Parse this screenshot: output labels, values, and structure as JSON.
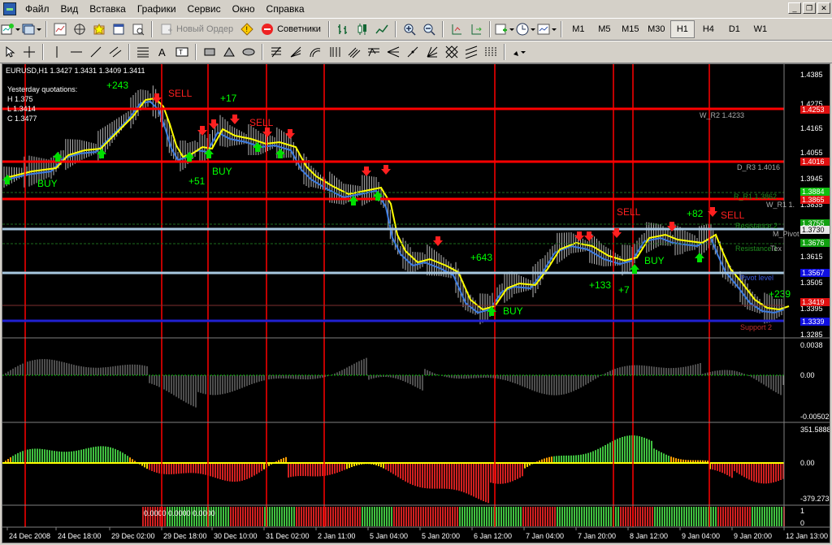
{
  "menu": [
    "Файл",
    "Вид",
    "Вставка",
    "Графики",
    "Сервис",
    "Окно",
    "Справка"
  ],
  "toolbar": {
    "new_order": "Новый Ордер",
    "experts": "Советники",
    "timeframes": [
      "M1",
      "M5",
      "M15",
      "M30",
      "H1",
      "H4",
      "D1",
      "W1"
    ],
    "active_timeframe": "H1"
  },
  "chart": {
    "symbol_line": "EURUSD,H1  1.3427 1.3431 1.3409 1.3411",
    "yesterday": {
      "title": "Yesterday quotations:",
      "h": "H 1.375",
      "l": "L 1.3414",
      "c": "C 1.3477"
    },
    "price_ticks": [
      "1.4385",
      "1.4275",
      "1.4165",
      "1.4055",
      "1.3945",
      "1.3835",
      "1.3725",
      "1.3615",
      "1.3505",
      "1.3395",
      "1.3285"
    ],
    "price_tags": [
      {
        "text": "1.4253",
        "color": "#e01010"
      },
      {
        "text": "1.4016",
        "color": "#e01010"
      },
      {
        "text": "1.3884",
        "color": "#10c010"
      },
      {
        "text": "1.3865",
        "color": "#e01010"
      },
      {
        "text": "1.3755",
        "color": "#10a010"
      },
      {
        "text": "1.3730",
        "color": "#e8e8e8"
      },
      {
        "text": "1.3676",
        "color": "#10a010"
      },
      {
        "text": "1.3567",
        "color": "#1010e0"
      },
      {
        "text": "1.3419",
        "color": "#e01010"
      },
      {
        "text": "1.3339",
        "color": "#1010e0"
      }
    ],
    "level_labels": {
      "wr2": "W_R2 1.4233",
      "dr3": "D_R3 1.4016",
      "wr1": "W_R1 1.",
      "pivot_w": "M_Pivot",
      "resistance2": "Resistance 2",
      "resistance1": "Resistance 1",
      "pivot_level": "Pivot level",
      "support2": "Support 2",
      "r1_partial": "R_R1 1.3862",
      "tex": "Tex"
    },
    "signals": {
      "sell": "SELL",
      "buy": "BUY",
      "p243": "+243",
      "p17": "+17",
      "p51": "+51",
      "p643": "+643",
      "p133": "+133",
      "p7": "+7",
      "p82": "+82",
      "p239": "+239"
    },
    "osc1_ticks": [
      "0.0038",
      "0.00",
      "-0.00502"
    ],
    "osc2_ticks": [
      "351.5888",
      "0.00",
      "-379.273"
    ],
    "osc3_ticks": [
      "1",
      "0"
    ],
    "osc3_label": "0.0000 0.0000 0.0000",
    "time_labels": [
      "24 Dec 2008",
      "24 Dec 18:00",
      "29 Dec 02:00",
      "29 Dec 18:00",
      "30 Dec 10:00",
      "31 Dec 02:00",
      "2 Jan 11:00",
      "5 Jan 04:00",
      "5 Jan 20:00",
      "6 Jan 12:00",
      "7 Jan 04:00",
      "7 Jan 20:00",
      "8 Jan 12:00",
      "9 Jan 04:00",
      "9 Jan 20:00",
      "12 Jan 13:00"
    ],
    "colors": {
      "bg": "#000000",
      "red_line": "#ff0000",
      "blue_line": "#3c7be0",
      "yellow_line": "#ffff00",
      "green": "#00ff00",
      "sell_arrow": "#ff2020",
      "buy_arrow": "#00e000"
    }
  }
}
